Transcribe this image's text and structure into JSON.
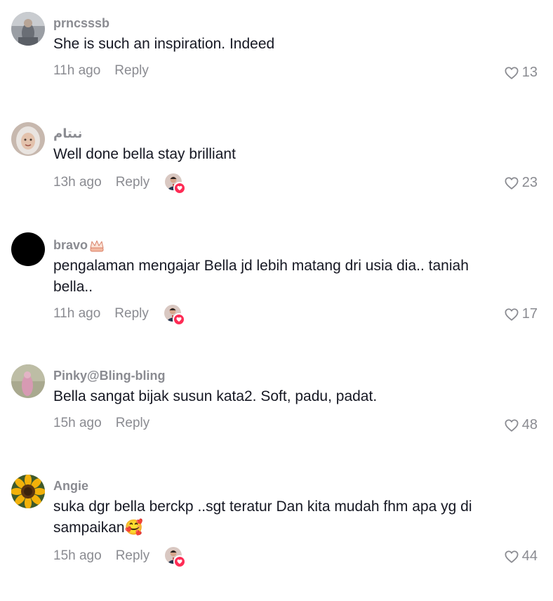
{
  "comments": [
    {
      "username": "prncsssb",
      "text": "She is such an inspiration. Indeed",
      "time": "11h ago",
      "reply_label": "Reply",
      "like_count": "13",
      "avatar_icon": "profile-photo",
      "creator_liked": false
    },
    {
      "username": "نىتام",
      "text": "Well done bella stay brilliant",
      "time": "13h ago",
      "reply_label": "Reply",
      "like_count": "23",
      "avatar_icon": "profile-photo",
      "creator_liked": true
    },
    {
      "username": "bravo",
      "text": "pengalaman mengajar Bella jd lebih matang dri usia dia.. taniah bella..",
      "time": "11h ago",
      "reply_label": "Reply",
      "like_count": "17",
      "avatar_icon": "black-circle-avatar",
      "badge_icon": "crown-emoji",
      "creator_liked": true
    },
    {
      "username": "Pinky@Bling-bling",
      "text": "Bella sangat bijak susun kata2. Soft, padu, padat.",
      "time": "15h ago",
      "reply_label": "Reply",
      "like_count": "48",
      "avatar_icon": "profile-photo",
      "creator_liked": false
    },
    {
      "username": "Angie",
      "text": "suka dgr bella berckp ..sgt teratur Dan kita mudah fhm apa yg di sampaikan🥰",
      "time": "15h ago",
      "reply_label": "Reply",
      "like_count": "44",
      "avatar_icon": "sunflower-avatar",
      "creator_liked": true
    }
  ],
  "colors": {
    "text": "#161823",
    "secondary": "#8a8b91",
    "heart_accent": "#fe2c55"
  }
}
